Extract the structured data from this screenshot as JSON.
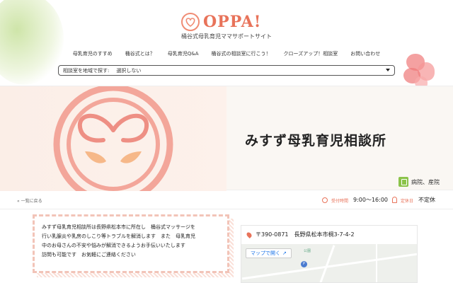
{
  "site": {
    "logo_text": "OPPA!",
    "tagline": "桶谷式母乳育児ママサポートサイト"
  },
  "nav": {
    "items": [
      "母乳育児のすすめ",
      "桶谷式とは？",
      "母乳育児Q&A",
      "桶谷式の相談室に行こう！",
      "クローズアップ！相談室",
      "お問い合わせ"
    ]
  },
  "region_select": {
    "label": "相談室を地域で探す:",
    "value": "選択しない"
  },
  "facility": {
    "name": "みすず母乳育児相談所",
    "category": "病院、産院"
  },
  "infobar": {
    "back_label": "« 一覧に戻る",
    "hours_label": "受付時間",
    "hours_value": "9:00～16:00",
    "holiday_label": "定休日",
    "holiday_value": "不定休"
  },
  "description": {
    "lines": [
      "みすず母乳育児相談所は長野県松本市に所在し　桶谷式マッサージを",
      "行い乳腺炎や乳房のしこり等トラブルを解消します　また　母乳育児",
      "中のお母さんの不安や悩みが解消できるようお手伝いいたします",
      "訪問も可能です　お気軽にご連絡ください"
    ]
  },
  "address": {
    "zip": "〒390-0871",
    "text": "長野県松本市桐3-7-4-2"
  },
  "map": {
    "open_label": "マップで開く",
    "poi_1": "公園",
    "poi_2": "P"
  },
  "colors": {
    "accent": "#e8735a",
    "category_green": "#8bc34a"
  }
}
